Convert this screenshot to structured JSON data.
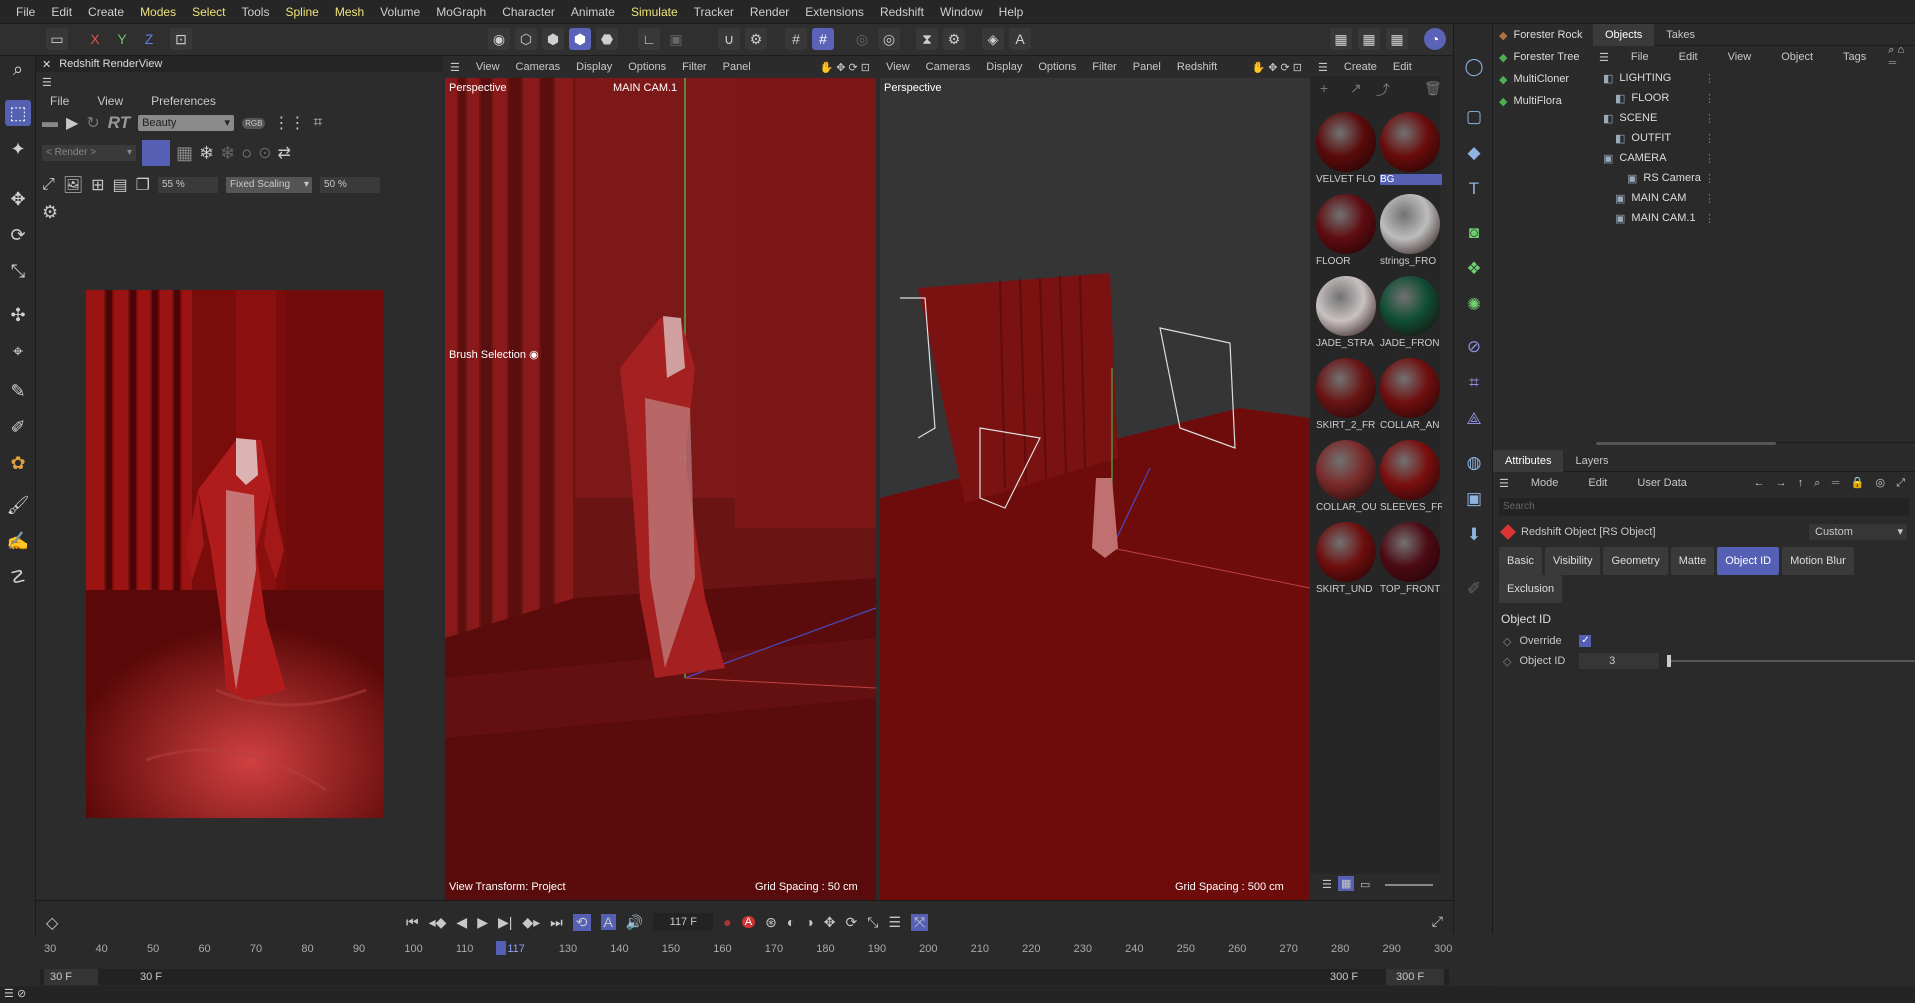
{
  "menubar": [
    "File",
    "Edit",
    "Create",
    "Modes",
    "Select",
    "Tools",
    "Spline",
    "Mesh",
    "Volume",
    "MoGraph",
    "Character",
    "Animate",
    "Simulate",
    "Tracker",
    "Render",
    "Extensions",
    "Redshift",
    "Window",
    "Help"
  ],
  "menubar_highlight": [
    "Modes",
    "Select",
    "Spline",
    "Mesh",
    "Simulate"
  ],
  "toolbar": {
    "x_label": "X",
    "y_label": "Y",
    "z_label": "Z"
  },
  "renderview": {
    "title": "Redshift RenderView",
    "menu": [
      "File",
      "View",
      "Preferences"
    ],
    "rt_label": "RT",
    "aov_select": "Beauty",
    "rgb_label": "RGB",
    "render_select": "< Render >",
    "zoom_value": "55 %",
    "scaling_select": "Fixed Scaling",
    "scale_value": "50 %"
  },
  "viewport1": {
    "menu": [
      "View",
      "Cameras",
      "Display",
      "Options",
      "Filter",
      "Panel"
    ],
    "name": "Perspective",
    "camera": "MAIN CAM.1",
    "brush_label": "Brush Selection",
    "transform": "View Transform: Project",
    "grid": "Grid Spacing : 50 cm"
  },
  "viewport2": {
    "menu": [
      "View",
      "Cameras",
      "Display",
      "Options",
      "Filter",
      "Panel",
      "Redshift"
    ],
    "name": "Perspective",
    "grid": "Grid Spacing : 500 cm"
  },
  "materials_menu": [
    "Create",
    "Edit"
  ],
  "materials": [
    {
      "name": "VELVET FLO",
      "color": "#5a0b0b"
    },
    {
      "name": "BG",
      "color": "#6a0c0c",
      "selected": true
    },
    {
      "name": "FLOOR",
      "color": "#5e0c10"
    },
    {
      "name": "strings_FRO",
      "color": "#bdbdbd"
    },
    {
      "name": "JADE_STRA",
      "color": "#c9c1c1"
    },
    {
      "name": "JADE_FRON",
      "color": "#0f4d34"
    },
    {
      "name": "SKIRT_2_FR",
      "color": "#6a1414"
    },
    {
      "name": "COLLAR_AN",
      "color": "#700f0f"
    },
    {
      "name": "COLLAR_OU",
      "color": "#7a2a2a"
    },
    {
      "name": "SLEEVES_FR",
      "color": "#7a0f0f"
    },
    {
      "name": "SKIRT_UND",
      "color": "#6e0e0e"
    },
    {
      "name": "TOP_FRONT",
      "color": "#4c0a14"
    }
  ],
  "generators": [
    "Forester Rock",
    "Forester Tree",
    "MultiCloner",
    "MultiFlora"
  ],
  "objects_tabs": [
    "Objects",
    "Takes"
  ],
  "objects_menu": [
    "File",
    "Edit",
    "View",
    "Object",
    "Tags"
  ],
  "objects": [
    {
      "name": "LIGHTING",
      "indent": 0
    },
    {
      "name": "FLOOR",
      "indent": 1
    },
    {
      "name": "SCENE",
      "indent": 0
    },
    {
      "name": "OUTFIT",
      "indent": 1
    },
    {
      "name": "CAMERA",
      "indent": 0
    },
    {
      "name": "RS Camera",
      "indent": 2
    },
    {
      "name": "MAIN CAM",
      "indent": 1
    },
    {
      "name": "MAIN CAM.1",
      "indent": 1
    }
  ],
  "attributes": {
    "tabs": [
      "Attributes",
      "Layers"
    ],
    "menu": [
      "Mode",
      "Edit",
      "User Data"
    ],
    "search_placeholder": "Search",
    "object_title": "Redshift Object [RS Object]",
    "preset": "Custom",
    "section_tabs": [
      "Basic",
      "Visibility",
      "Geometry",
      "Matte",
      "Object ID",
      "Motion Blur",
      "Exclusion"
    ],
    "active_tab": "Object ID",
    "section_title": "Object ID",
    "override_label": "Override",
    "override_checked": true,
    "objid_label": "Object ID",
    "objid_value": "3"
  },
  "timeline": {
    "current_frame": "117 F",
    "ticks": [
      "30",
      "40",
      "50",
      "60",
      "70",
      "80",
      "90",
      "100",
      "110",
      "117",
      "130",
      "140",
      "150",
      "160",
      "170",
      "180",
      "190",
      "200",
      "210",
      "220",
      "230",
      "240",
      "250",
      "260",
      "270",
      "280",
      "290",
      "300"
    ],
    "start_a": "30 F",
    "start_b": "30 F",
    "end_a": "300 F",
    "end_b": "300 F"
  }
}
